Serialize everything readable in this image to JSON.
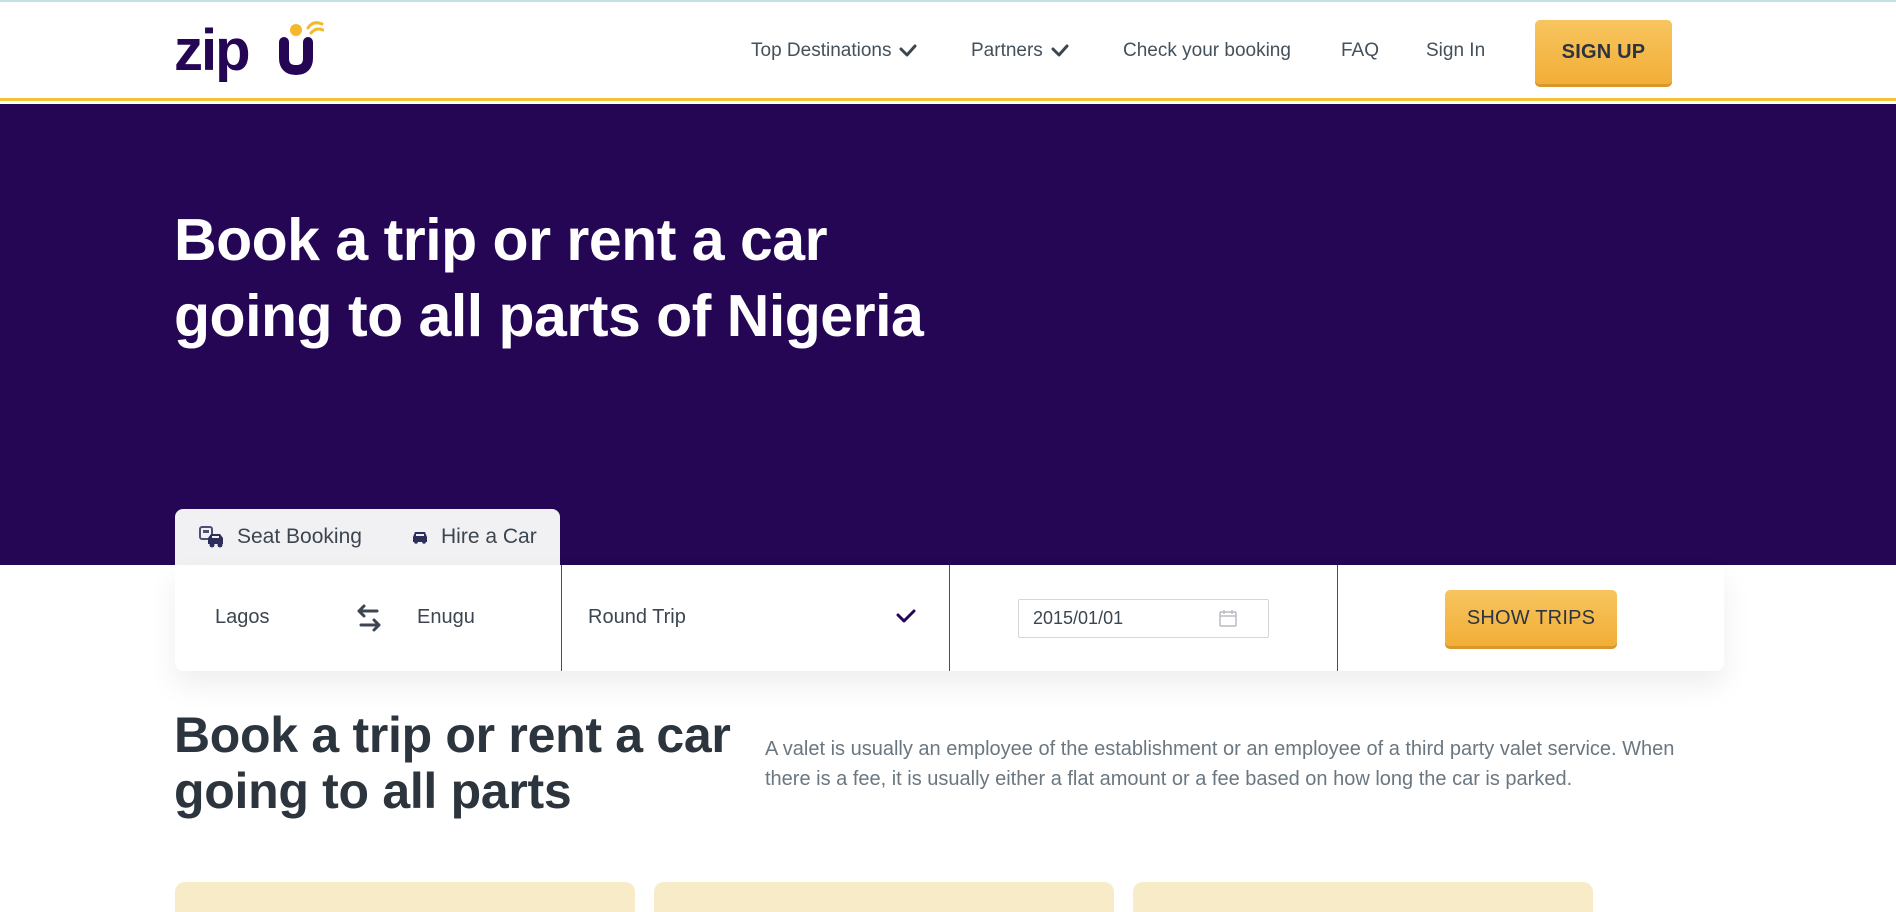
{
  "header": {
    "logo_text": "zipu",
    "nav": {
      "top_destinations": "Top Destinations",
      "partners": "Partners",
      "check_booking": "Check your booking",
      "faq": "FAQ",
      "sign_in": "Sign In"
    },
    "signup_label": "SIGN UP"
  },
  "hero": {
    "title_line1": "Book a trip or rent a car",
    "title_line2": "going to all parts of Nigeria"
  },
  "booking": {
    "tabs": {
      "seat": "Seat Booking",
      "car": "Hire a Car"
    },
    "from": "Lagos",
    "to": "Enugu",
    "trip_type": "Round Trip",
    "date": "2015/01/01",
    "show_trips_label": "SHOW TRIPS"
  },
  "intro": {
    "title": "Book a trip or rent a car going to all parts",
    "text": "A valet is usually an employee of the establishment or an employee of a third party valet service. When there is a fee, it is usually either a flat amount or a fee based on how long the car is parked."
  },
  "colors": {
    "brand_purple": "#250654",
    "accent_yellow": "#f4c234",
    "card_bg": "#f7ecc7"
  },
  "icons": {
    "nav_dropdown": "chevron-down-icon",
    "seat_tab": "bus-seat-icon",
    "car_tab": "car-icon",
    "swap": "swap-arrows-icon",
    "trip_dropdown": "chevron-down-icon",
    "date": "calendar-icon"
  }
}
